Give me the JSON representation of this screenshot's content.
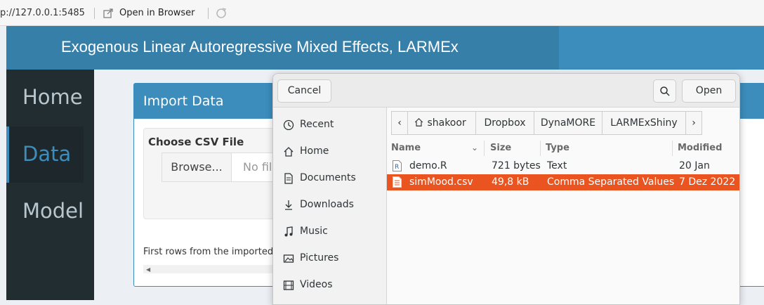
{
  "browser": {
    "url": "p://127.0.0.1:5485",
    "open_in_browser": "Open in Browser"
  },
  "app": {
    "title": "Exogenous Linear Autoregressive Mixed Effects, LARMEx",
    "nav": [
      {
        "label": "Home",
        "active": false
      },
      {
        "label": "Data",
        "active": true
      },
      {
        "label": "Model",
        "active": false
      }
    ],
    "import_box": {
      "title": "Import Data",
      "choose_label": "Choose CSV File",
      "browse_label": "Browse...",
      "file_placeholder": "No file selected",
      "first_rows_text": "First rows from the imported data"
    }
  },
  "dialog": {
    "cancel_label": "Cancel",
    "open_label": "Open",
    "places": [
      {
        "label": "Recent",
        "icon": "clock-icon"
      },
      {
        "label": "Home",
        "icon": "home-icon"
      },
      {
        "label": "Documents",
        "icon": "document-icon"
      },
      {
        "label": "Downloads",
        "icon": "download-icon"
      },
      {
        "label": "Music",
        "icon": "music-icon"
      },
      {
        "label": "Pictures",
        "icon": "picture-icon"
      },
      {
        "label": "Videos",
        "icon": "video-icon"
      }
    ],
    "path": [
      "shakoor",
      "Dropbox",
      "DynaMORE",
      "LARMExShiny"
    ],
    "columns": {
      "name": "Name",
      "size": "Size",
      "type": "Type",
      "modified": "Modified"
    },
    "files": [
      {
        "name": "demo.R",
        "size": "721 bytes",
        "type": "Text",
        "modified": "20 Jan",
        "selected": false
      },
      {
        "name": "simMood.csv",
        "size": "49,8 kB",
        "type": "Comma Separated Values",
        "modified": "7 Dez 2022",
        "selected": true
      }
    ],
    "colors": {
      "selection": "#e95420",
      "header_blue": "#3c8dbc"
    }
  }
}
